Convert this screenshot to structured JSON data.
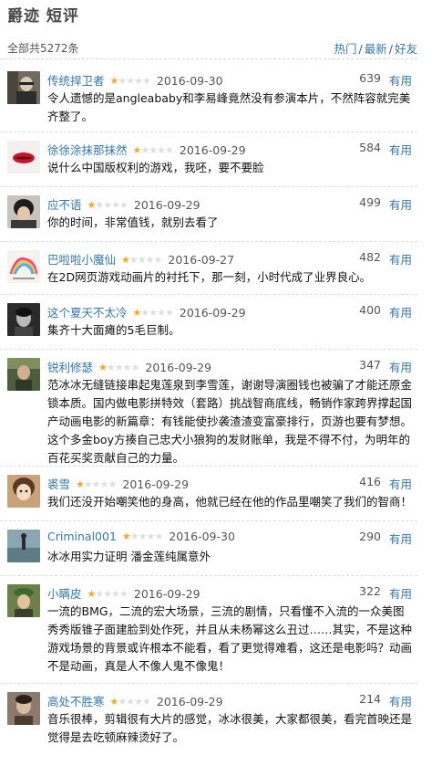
{
  "page": {
    "title": "爵迹 短评",
    "total": "全部共5272条",
    "sorts": [
      "热门",
      "最新",
      "好友"
    ]
  },
  "comments": [
    {
      "user": "传统捍卫者",
      "rating": 1,
      "date": "2016-09-30",
      "votes": "639",
      "useful": "有用",
      "text": "令人遗憾的是angleababy和李易峰竟然没有参演本片，不然阵容就完美齐整了。"
    },
    {
      "user": "徐徐涂抹那抹然",
      "rating": 1,
      "date": "2016-09-29",
      "votes": "584",
      "useful": "有用",
      "text": "说什么中国版权利的游戏，我呸，要不要脸"
    },
    {
      "user": "应不语",
      "rating": 1,
      "date": "2016-09-29",
      "votes": "499",
      "useful": "有用",
      "text": "你的时间，非常值钱，就别去看了"
    },
    {
      "user": "巴啦啦小魔仙",
      "rating": 1,
      "date": "2016-09-27",
      "votes": "482",
      "useful": "有用",
      "text": "在2D网页游戏动画片的衬托下，那一刻，小时代成了业界良心。"
    },
    {
      "user": "这个夏天不太冷",
      "rating": 1,
      "date": "2016-09-29",
      "votes": "400",
      "useful": "有用",
      "text": "集齐十大面瘫的5毛巨制。"
    },
    {
      "user": "锐利修瑟",
      "rating": 1,
      "date": "2016-09-29",
      "votes": "347",
      "useful": "有用",
      "text": "范冰冰无缝链接串起鬼莲泉到李雪莲，谢谢导演圈钱也被骗了才能还原金锁本质。国内做电影拼特效（套路）挑战智商底线，畅销作家跨界撑起国产动画电影的新篇章：有钱能使抄袭渣渣变富豪排行，页游也要有梦想。这个多金boy方揍自己忠犬小狼狗的发财账单，我是不得不付，为明年的百花买奖贡献自己的力量。"
    },
    {
      "user": "裘雪",
      "rating": 1,
      "date": "2016-09-29",
      "votes": "416",
      "useful": "有用",
      "text": "我们还没开始嘲笑他的身高，他就已经在他的作品里嘲笑了我们的智商！"
    },
    {
      "user": "Criminal001",
      "rating": 1,
      "date": "2016-09-30",
      "votes": "290",
      "useful": "有用",
      "text": "冰冰用实力证明 潘金莲纯属意外"
    },
    {
      "user": "小瞒皮",
      "rating": 1,
      "date": "2016-09-29",
      "votes": "322",
      "useful": "有用",
      "text": "一流的BMG，二流的宏大场景，三流的剧情，只看懂不入流的一众美图秀秀版锥子面建脸到处作死，并且从未杨幂这么丑过……其实，不是这种游戏场景的背景或许根本不能看，看了更觉得难看，这还是电影吗？动画不是动画，真是人不像人鬼不像鬼！"
    },
    {
      "user": "高处不胜寒",
      "rating": 1,
      "date": "2016-09-29",
      "votes": "214",
      "useful": "有用",
      "text": "音乐很棒，剪辑很有大片的感觉，冰冰很美，大家都很美，看完首映还是觉得是去吃顿麻辣烫好了。"
    }
  ],
  "avatars": [
    {
      "name": "man-with-glasses",
      "bg": "#6f6a5e"
    },
    {
      "name": "red-lips",
      "bg": "#f4f0f0"
    },
    {
      "name": "dark-hair-person",
      "bg": "#c9c3bd"
    },
    {
      "name": "rainbow-unicorn",
      "bg": "#f6f3ee"
    },
    {
      "name": "black-white-portrait",
      "bg": "#2a2a2a"
    },
    {
      "name": "outdoor-man",
      "bg": "#4e5d3b"
    },
    {
      "name": "anime-girl",
      "bg": "#c9a27a"
    },
    {
      "name": "ocean-figure",
      "bg": "#8aa6b0"
    },
    {
      "name": "green-hat-person",
      "bg": "#6d7f4a"
    },
    {
      "name": "portrait-person",
      "bg": "#8c7a6c"
    }
  ]
}
